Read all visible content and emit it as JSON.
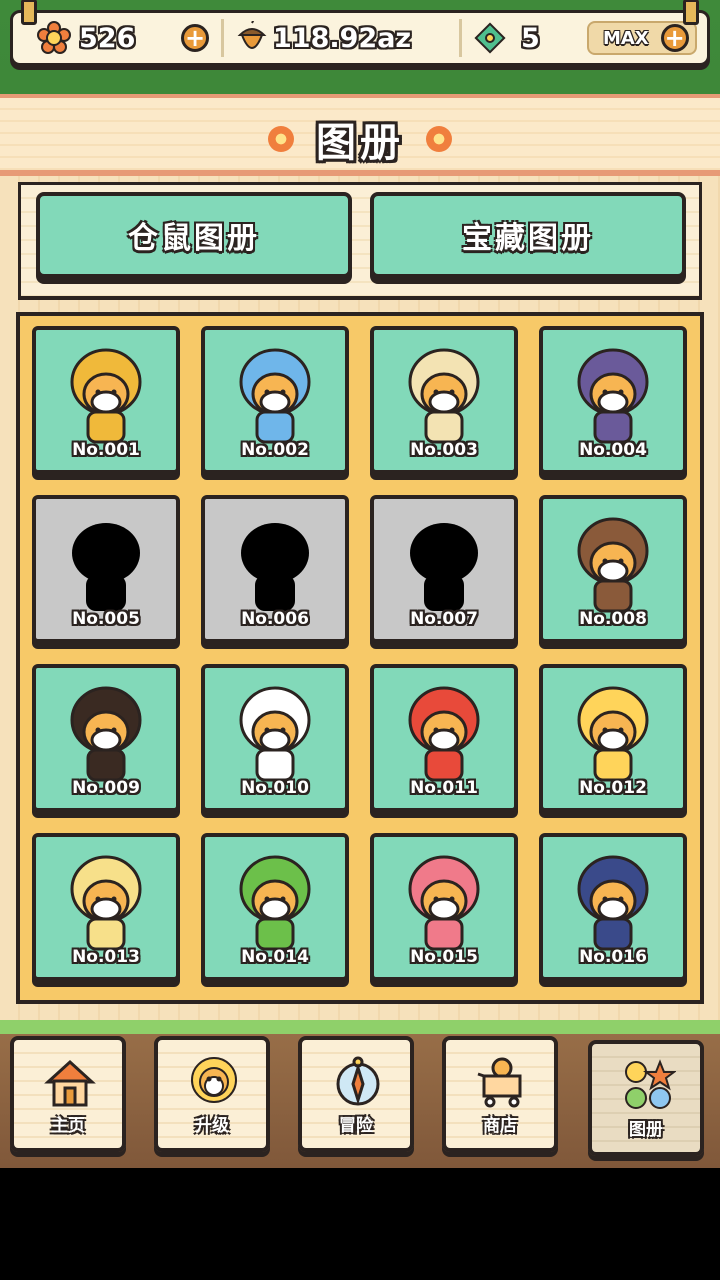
{
  "resources": {
    "flowers": "526",
    "acorns": "118.92az",
    "tickets": "5",
    "max_label": "MAX"
  },
  "title": "图册",
  "tabs": [
    {
      "label": "仓鼠图册"
    },
    {
      "label": "宝藏图册"
    }
  ],
  "collection": [
    {
      "num": "No.001",
      "unlocked": true,
      "costume": "emperor"
    },
    {
      "num": "No.002",
      "unlocked": true,
      "costume": "fish"
    },
    {
      "num": "No.003",
      "unlocked": true,
      "costume": "eskimo"
    },
    {
      "num": "No.004",
      "unlocked": true,
      "costume": "vampire"
    },
    {
      "num": "No.005",
      "unlocked": false,
      "costume": "antler-silhouette"
    },
    {
      "num": "No.006",
      "unlocked": false,
      "costume": "sombrero-silhouette"
    },
    {
      "num": "No.007",
      "unlocked": false,
      "costume": "bear-silhouette"
    },
    {
      "num": "No.008",
      "unlocked": true,
      "costume": "cowboy"
    },
    {
      "num": "No.009",
      "unlocked": true,
      "costume": "afro"
    },
    {
      "num": "No.010",
      "unlocked": true,
      "costume": "bunny"
    },
    {
      "num": "No.011",
      "unlocked": true,
      "costume": "strawberry"
    },
    {
      "num": "No.012",
      "unlocked": true,
      "costume": "bee"
    },
    {
      "num": "No.013",
      "unlocked": true,
      "costume": "egg"
    },
    {
      "num": "No.014",
      "unlocked": true,
      "costume": "frog"
    },
    {
      "num": "No.015",
      "unlocked": true,
      "costume": "flower-fairy"
    },
    {
      "num": "No.016",
      "unlocked": true,
      "costume": "wizard"
    }
  ],
  "nav": [
    {
      "label": "主页",
      "icon": "house-icon"
    },
    {
      "label": "升级",
      "icon": "sunflower-hamster-icon"
    },
    {
      "label": "冒险",
      "icon": "compass-icon"
    },
    {
      "label": "商店",
      "icon": "shop-cart-icon"
    },
    {
      "label": "图册",
      "icon": "album-icon",
      "active": true
    }
  ],
  "colors": {
    "card_owned": "#82d9b9",
    "card_locked": "#c8c8c8",
    "panel": "#f7c968",
    "outline": "#2b2320"
  }
}
